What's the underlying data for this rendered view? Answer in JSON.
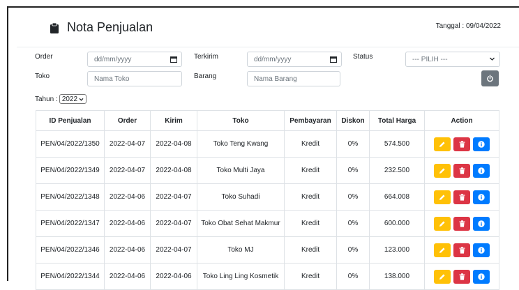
{
  "header": {
    "title": "Nota Penjualan",
    "date_text": "Tanggal : 09/04/2022"
  },
  "filters": {
    "order_label": "Order",
    "order_placeholder": "dd/mm/yyyy",
    "terkirim_label": "Terkirim",
    "terkirim_placeholder": "dd/mm/yyyy",
    "status_label": "Status",
    "status_value": "--- PILIH ---",
    "toko_label": "Toko",
    "toko_placeholder": "Nama Toko",
    "barang_label": "Barang",
    "barang_placeholder": "Nama Barang",
    "tahun_label": "Tahun :",
    "tahun_value": "2022"
  },
  "table": {
    "headers": [
      "ID Penjualan",
      "Order",
      "Kirim",
      "Toko",
      "Pembayaran",
      "Diskon",
      "Total Harga",
      "Action"
    ],
    "rows": [
      {
        "id": "PEN/04/2022/1350",
        "order": "2022-04-07",
        "kirim": "2022-04-08",
        "toko": "Toko Teng Kwang",
        "pembayaran": "Kredit",
        "diskon": "0%",
        "total": "574.500"
      },
      {
        "id": "PEN/04/2022/1349",
        "order": "2022-04-07",
        "kirim": "2022-04-08",
        "toko": "Toko Multi Jaya",
        "pembayaran": "Kredit",
        "diskon": "0%",
        "total": "232.500"
      },
      {
        "id": "PEN/04/2022/1348",
        "order": "2022-04-06",
        "kirim": "2022-04-07",
        "toko": "Toko Suhadi",
        "pembayaran": "Kredit",
        "diskon": "0%",
        "total": "664.008"
      },
      {
        "id": "PEN/04/2022/1347",
        "order": "2022-04-06",
        "kirim": "2022-04-07",
        "toko": "Toko Obat Sehat Makmur",
        "pembayaran": "Kredit",
        "diskon": "0%",
        "total": "600.000"
      },
      {
        "id": "PEN/04/2022/1346",
        "order": "2022-04-06",
        "kirim": "2022-04-07",
        "toko": "Toko MJ",
        "pembayaran": "Kredit",
        "diskon": "0%",
        "total": "123.000"
      },
      {
        "id": "PEN/04/2022/1344",
        "order": "2022-04-06",
        "kirim": "2022-04-06",
        "toko": "Toko Ling Ling Kosmetik",
        "pembayaran": "Kredit",
        "diskon": "0%",
        "total": "138.000"
      }
    ]
  },
  "icons": {
    "title": "clipboard-icon",
    "date_input": "calendar-icon",
    "reset": "power-icon",
    "edit": "pencil-icon",
    "delete": "trash-icon",
    "info": "info-icon"
  },
  "colors": {
    "edit": "#ffc107",
    "delete": "#dc3545",
    "info": "#007bff",
    "reset": "#6c757d"
  }
}
